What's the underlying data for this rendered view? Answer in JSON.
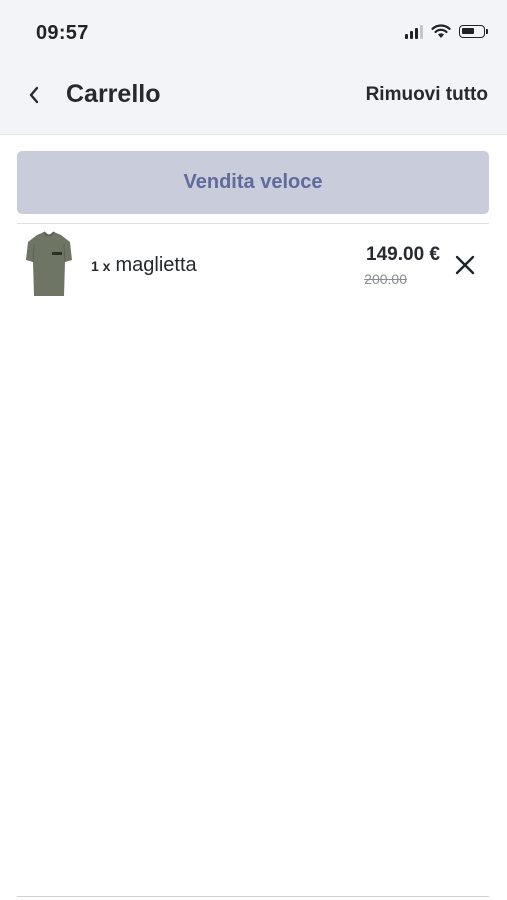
{
  "status_bar": {
    "time": "09:57",
    "icons": [
      "signal-icon",
      "wifi-icon",
      "battery-icon"
    ]
  },
  "nav": {
    "back_icon": "chevron-left-icon",
    "title": "Carrello",
    "remove_all_label": "Rimuovi tutto"
  },
  "quick_sale": {
    "label": "Vendita veloce",
    "colors": {
      "background": "#c9ccdb",
      "text": "#5f6b9a"
    }
  },
  "cart": {
    "items": [
      {
        "quantity": "1 x",
        "name": "maglietta",
        "price": "149.00 €",
        "original_price": "200.00",
        "thumbnail_icon": "tshirt-thumbnail",
        "remove_icon": "close-icon"
      }
    ]
  }
}
